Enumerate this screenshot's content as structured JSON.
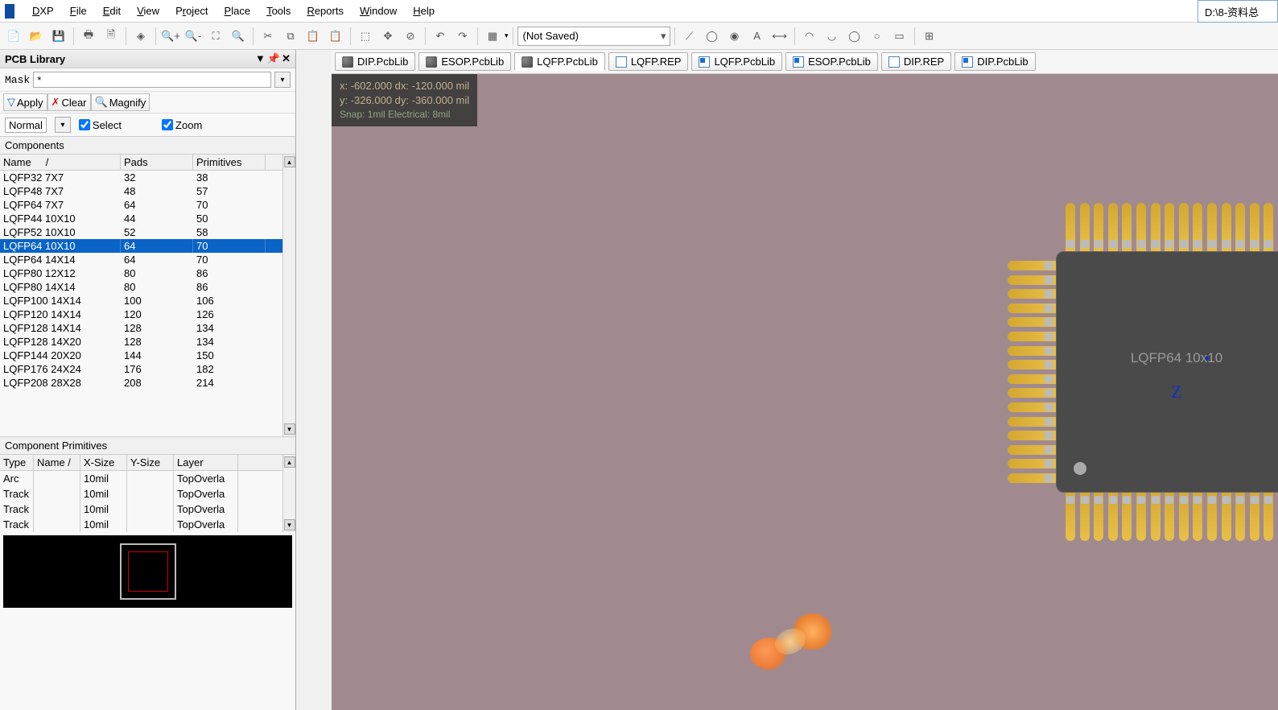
{
  "menu": {
    "items": [
      "DXP",
      "File",
      "Edit",
      "View",
      "Project",
      "Place",
      "Tools",
      "Reports",
      "Window",
      "Help"
    ],
    "underlines": [
      "D",
      "F",
      "E",
      "V",
      "r",
      "P",
      "T",
      "R",
      "W",
      "H"
    ]
  },
  "path": "D:\\8-资料总",
  "toolbar": {
    "combo": "(Not Saved)"
  },
  "panel": {
    "title": "PCB Library",
    "mask_label": "Mask",
    "mask_value": "*",
    "apply": "Apply",
    "clear": "Clear",
    "magnify": "Magnify",
    "mode": "Normal",
    "select": "Select",
    "zoom": "Zoom"
  },
  "components": {
    "header": "Components",
    "cols": [
      "Name",
      "Pads",
      "Primitives"
    ],
    "rows": [
      {
        "n": "LQFP32 7X7",
        "p": "32",
        "pr": "38"
      },
      {
        "n": "LQFP48 7X7",
        "p": "48",
        "pr": "57"
      },
      {
        "n": "LQFP64 7X7",
        "p": "64",
        "pr": "70"
      },
      {
        "n": "LQFP44 10X10",
        "p": "44",
        "pr": "50"
      },
      {
        "n": "LQFP52 10X10",
        "p": "52",
        "pr": "58"
      },
      {
        "n": "LQFP64 10X10",
        "p": "64",
        "pr": "70",
        "sel": true
      },
      {
        "n": "LQFP64 14X14",
        "p": "64",
        "pr": "70"
      },
      {
        "n": "LQFP80 12X12",
        "p": "80",
        "pr": "86"
      },
      {
        "n": "LQFP80 14X14",
        "p": "80",
        "pr": "86"
      },
      {
        "n": "LQFP100 14X14",
        "p": "100",
        "pr": "106"
      },
      {
        "n": "LQFP120 14X14",
        "p": "120",
        "pr": "126"
      },
      {
        "n": "LQFP128 14X14",
        "p": "128",
        "pr": "134"
      },
      {
        "n": "LQFP128 14X20",
        "p": "128",
        "pr": "134"
      },
      {
        "n": "LQFP144 20X20",
        "p": "144",
        "pr": "150"
      },
      {
        "n": "LQFP176 24X24",
        "p": "176",
        "pr": "182"
      },
      {
        "n": "LQFP208 28X28",
        "p": "208",
        "pr": "214"
      }
    ]
  },
  "primitives": {
    "header": "Component Primitives",
    "cols": [
      "Type",
      "Name",
      "X-Size",
      "Y-Size",
      "Layer"
    ],
    "rows": [
      {
        "t": "Arc",
        "n": "",
        "x": "10mil",
        "y": "",
        "l": "TopOverla"
      },
      {
        "t": "Track",
        "n": "",
        "x": "10mil",
        "y": "",
        "l": "TopOverla"
      },
      {
        "t": "Track",
        "n": "",
        "x": "10mil",
        "y": "",
        "l": "TopOverla"
      },
      {
        "t": "Track",
        "n": "",
        "x": "10mil",
        "y": "",
        "l": "TopOverla"
      }
    ]
  },
  "tabs": [
    {
      "label": "DIP.PcbLib",
      "ico": "lib"
    },
    {
      "label": "ESOP.PcbLib",
      "ico": "lib"
    },
    {
      "label": "LQFP.PcbLib",
      "ico": "lib",
      "active": true
    },
    {
      "label": "LQFP.REP",
      "ico": "doc"
    },
    {
      "label": "LQFP.PcbLib",
      "ico": "docx"
    },
    {
      "label": "ESOP.PcbLib",
      "ico": "docx"
    },
    {
      "label": "DIP.REP",
      "ico": "doc"
    },
    {
      "label": "DIP.PcbLib",
      "ico": "docx"
    }
  ],
  "coords": {
    "l1": "x:  -602.000   dx:  -120.000  mil",
    "l2": "y:  -326.000   dy:  -360.000  mil",
    "snap": "Snap: 1mil Electrical: 8mil"
  },
  "chip": {
    "label": "LQFP64 10x10",
    "z": "Z"
  }
}
